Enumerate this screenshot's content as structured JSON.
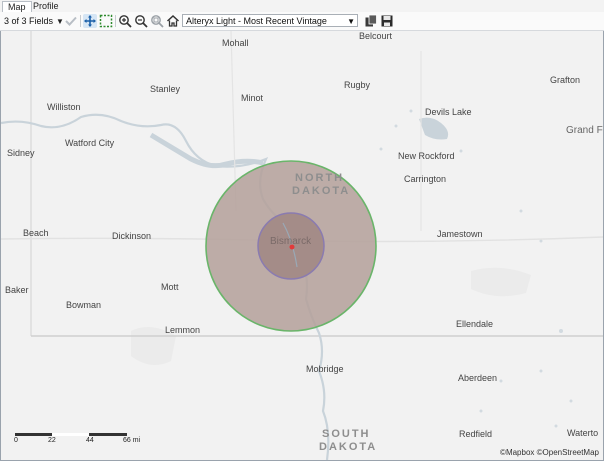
{
  "tabs": [
    {
      "label": "Map",
      "active": true
    },
    {
      "label": "Profile",
      "active": false
    }
  ],
  "toolbar": {
    "fields_label": "3 of 3 Fields",
    "basemap_select": "Alteryx Light - Most Recent Vintage",
    "icons": [
      "checkmark-icon",
      "pan-icon",
      "select-region-icon",
      "zoom-in-icon",
      "zoom-out-icon",
      "zoom-selection-icon",
      "home-icon",
      "copy-icon",
      "save-icon"
    ]
  },
  "map": {
    "states": {
      "north": "NORTH",
      "dakota_n": "DAKOTA",
      "south": "SOUTH",
      "dakota_s": "DAKOTA"
    },
    "places": {
      "mohall": "Mohall",
      "belcourt": "Belcourt",
      "stanley": "Stanley",
      "minot": "Minot",
      "rugby": "Rugby",
      "grafton": "Grafton",
      "williston": "Williston",
      "devils_lake": "Devils Lake",
      "grand_f": "Grand F",
      "watford_city": "Watford City",
      "sidney": "Sidney",
      "new_rockford": "New Rockford",
      "carrington": "Carrington",
      "beach": "Beach",
      "dickinson": "Dickinson",
      "bismarck": "Bismarck",
      "jamestown": "Jamestown",
      "baker": "Baker",
      "mott": "Mott",
      "bowman": "Bowman",
      "lemmon": "Lemmon",
      "ellendale": "Ellendale",
      "mobridge": "Mobridge",
      "aberdeen": "Aberdeen",
      "redfield": "Redfield",
      "waterto": "Waterto"
    },
    "scale_ticks": [
      "0",
      "22",
      "44",
      "66 mi"
    ],
    "attribution": "©Mapbox ©OpenStreetMap",
    "colors": {
      "outer_fill": "#b4a09a",
      "outer_stroke": "#6ab56a",
      "inner_fill": "#a48c88",
      "inner_stroke": "#8a7bb0",
      "point": "#e23a3a",
      "water": "#c9d3da"
    }
  }
}
